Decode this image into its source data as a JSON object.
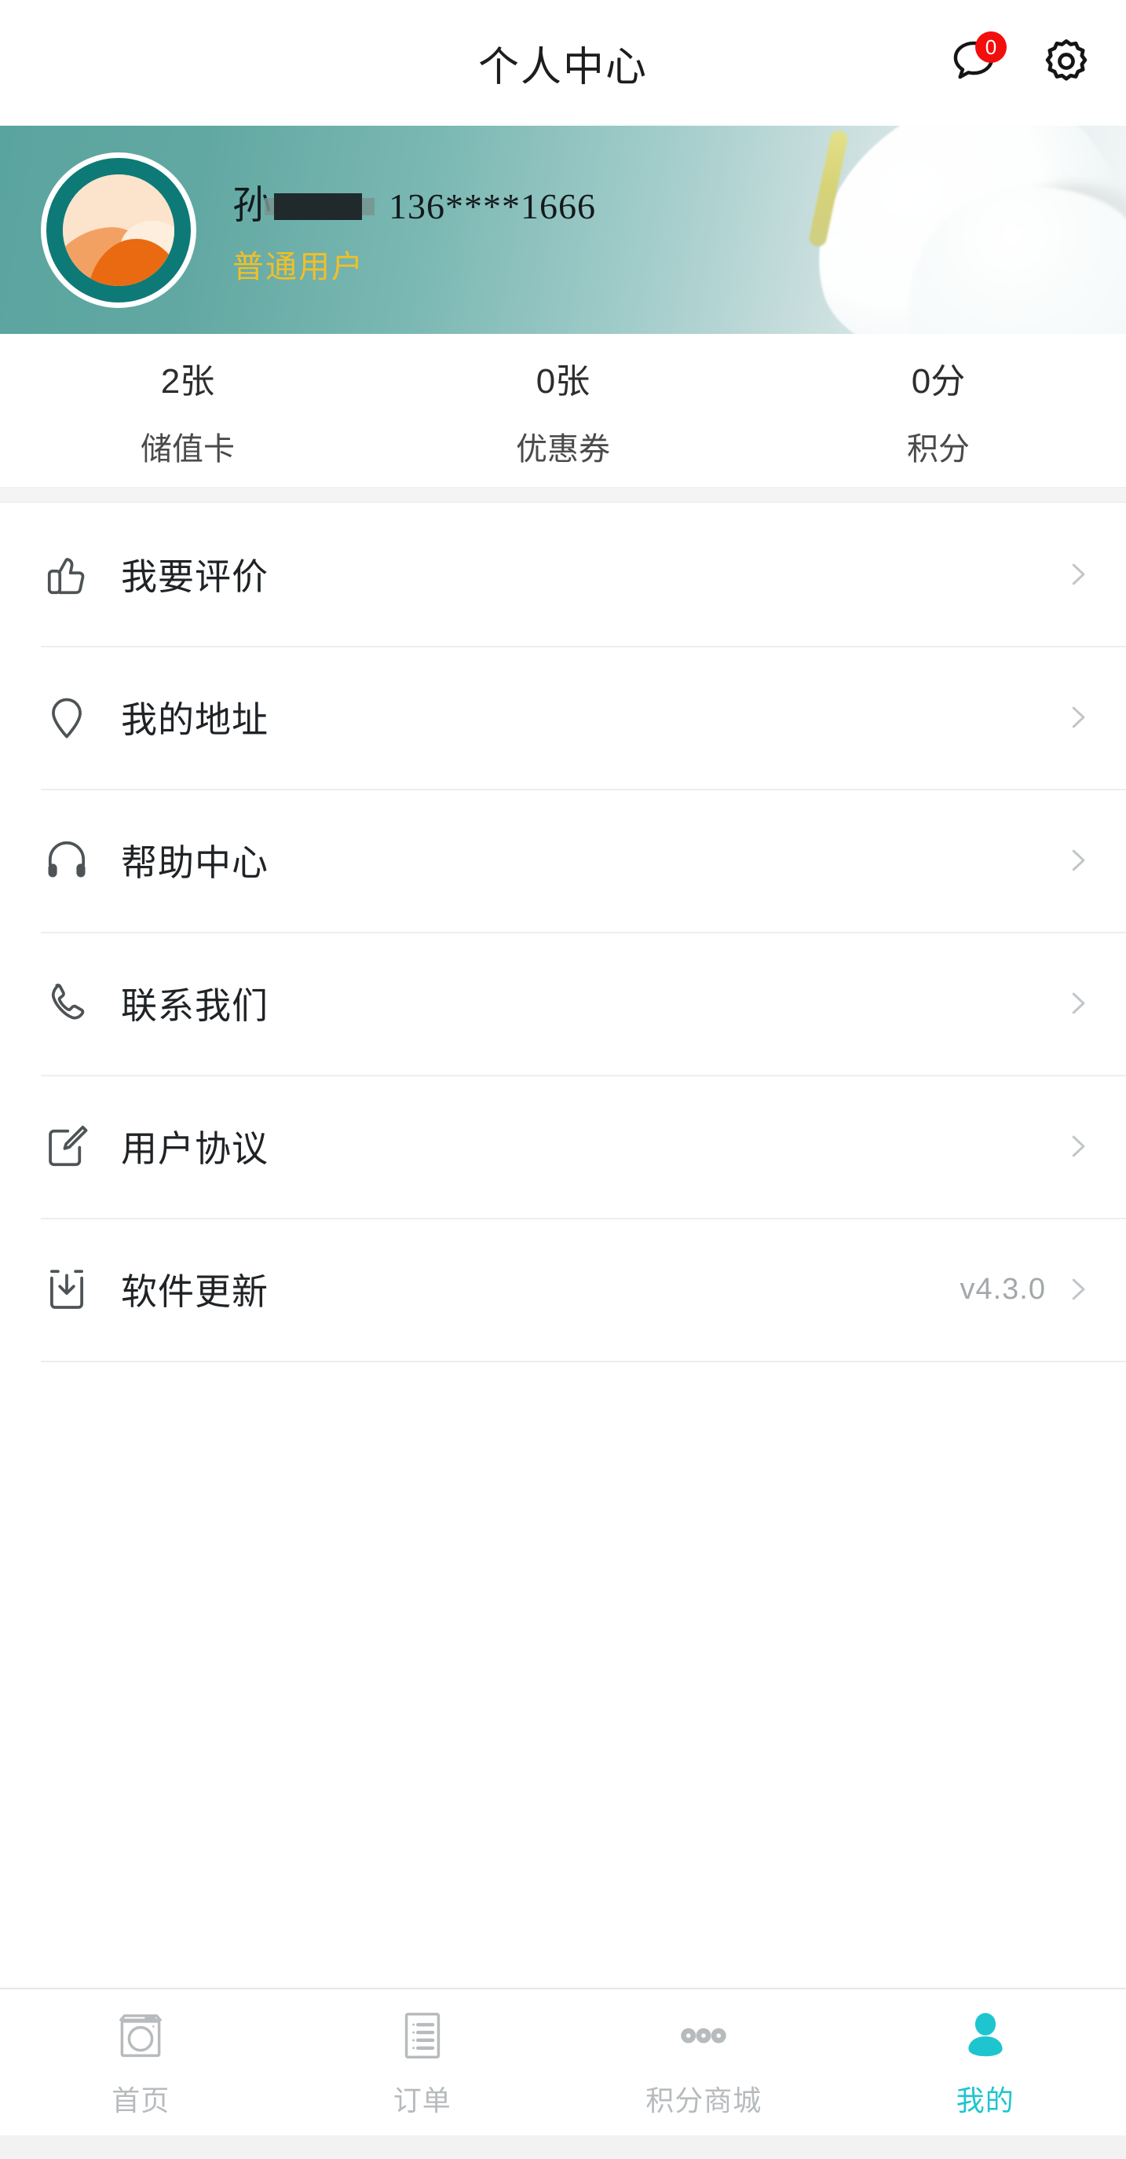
{
  "header": {
    "title": "个人中心",
    "message_icon": "speech-bubble-icon",
    "message_badge": "0",
    "settings_icon": "gear-icon"
  },
  "profile": {
    "avatar_icon": "user-avatar-landscape",
    "name": "孙",
    "name_redacted": true,
    "phone": "136****1666",
    "level": "普通用户",
    "level_color": "#f2bf27",
    "banner_gradient_start": "#5aa49f",
    "banner_gradient_end": "#f2f6f6",
    "banner_decoration": "calla-lily-flower"
  },
  "stats": [
    {
      "value": "2张",
      "label": "储值卡"
    },
    {
      "value": "0张",
      "label": "优惠券"
    },
    {
      "value": "0分",
      "label": "积分"
    }
  ],
  "menu": [
    {
      "label": "我要评价",
      "icon": "thumbs-up-icon",
      "value": "",
      "arrow": "chevron-right-icon"
    },
    {
      "label": "我的地址",
      "icon": "location-pin-icon",
      "value": "",
      "arrow": "chevron-right-icon"
    },
    {
      "label": "帮助中心",
      "icon": "headset-icon",
      "value": "",
      "arrow": "chevron-right-icon"
    },
    {
      "label": "联系我们",
      "icon": "phone-icon",
      "value": "",
      "arrow": "chevron-right-icon"
    },
    {
      "label": "用户协议",
      "icon": "edit-document-icon",
      "value": "",
      "arrow": "chevron-right-icon"
    },
    {
      "label": "软件更新",
      "icon": "download-icon",
      "value": "v4.3.0",
      "arrow": "chevron-right-icon"
    }
  ],
  "tabbar": {
    "active_color": "#1ec5cf",
    "inactive_color": "#b7bbbd",
    "items": [
      {
        "label": "首页",
        "icon": "washing-machine-icon",
        "active": false
      },
      {
        "label": "订单",
        "icon": "order-list-icon",
        "active": false
      },
      {
        "label": "积分商城",
        "icon": "three-dots-icon",
        "active": false
      },
      {
        "label": "我的",
        "icon": "person-icon",
        "active": true
      }
    ]
  }
}
